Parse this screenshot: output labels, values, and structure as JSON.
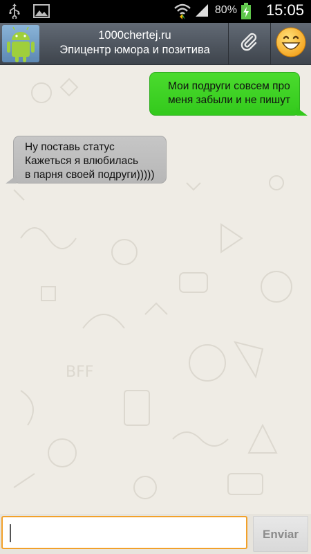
{
  "status_bar": {
    "icons_left": [
      "usb-icon",
      "image-icon"
    ],
    "icons_right": [
      "wifi-icon",
      "signal-icon",
      "battery-charging-icon"
    ],
    "battery": "80%",
    "time": "15:05"
  },
  "header": {
    "title": "1000chertej.ru",
    "subtitle": "Эпицентр юмора и позитива",
    "avatar_icon": "android-icon",
    "attach_icon": "paperclip-icon",
    "emoji_icon": "smiley-icon"
  },
  "messages": [
    {
      "direction": "outgoing",
      "lines": [
        "Мои подруги совсем про",
        "меня забыли и не пишут"
      ]
    },
    {
      "direction": "incoming",
      "lines": [
        "Ну поставь статус",
        "Кажеться я влюбилась",
        "в парня своей подруги)))))"
      ]
    }
  ],
  "composer": {
    "value": "",
    "send_label": "Enviar"
  },
  "colors": {
    "outgoing_bubble": "#3fd226",
    "incoming_bubble": "#bdbdbd",
    "input_focus": "#f2a12a",
    "header": "#4e555e"
  }
}
